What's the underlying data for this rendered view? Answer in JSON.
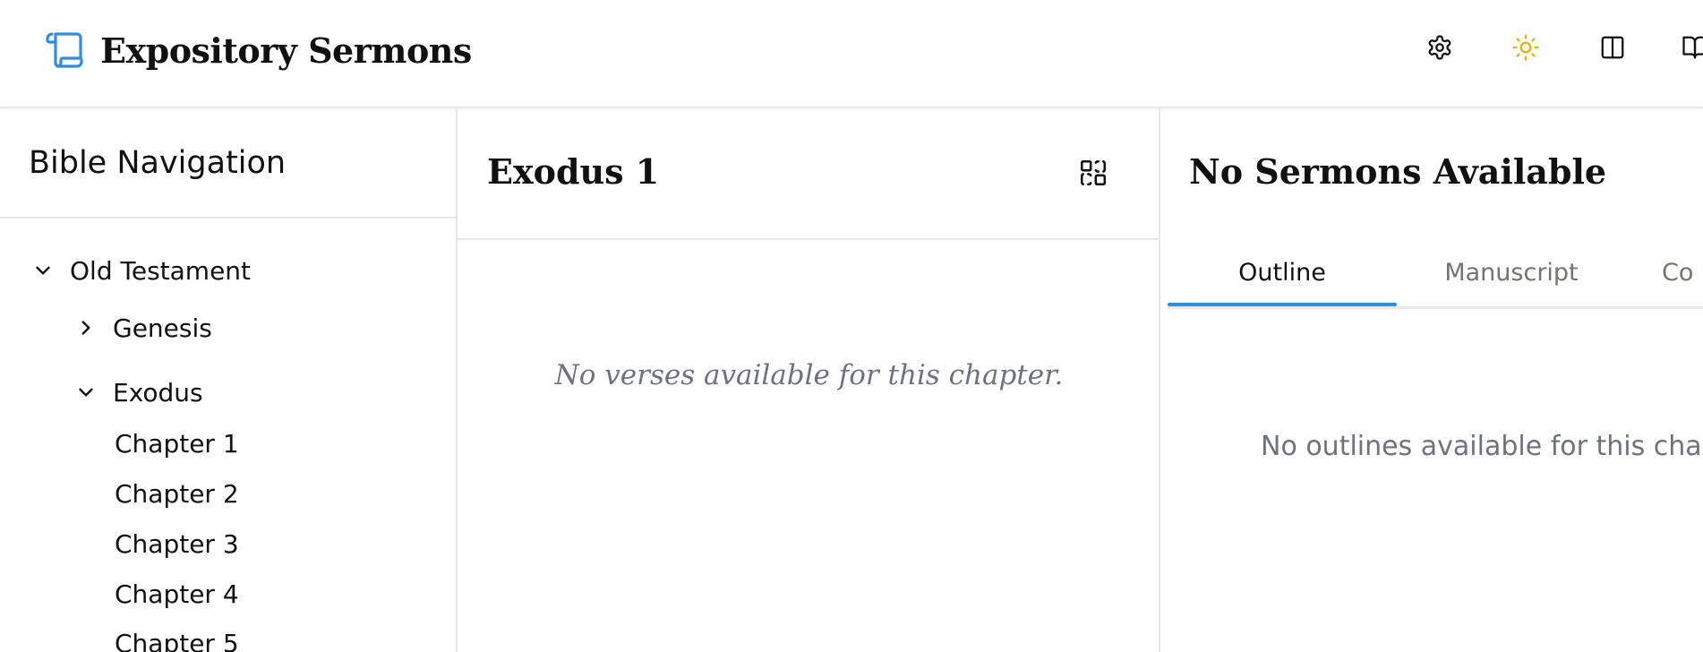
{
  "app": {
    "title": "Expository Sermons",
    "logo_icon": "scroll-icon",
    "accent_color": "#2e8ee0"
  },
  "header_actions": [
    {
      "name": "settings",
      "icon": "gear-icon"
    },
    {
      "name": "theme",
      "icon": "sun-icon",
      "color": "#eab308"
    },
    {
      "name": "layout",
      "icon": "columns-icon"
    },
    {
      "name": "reader",
      "icon": "book-open-icon"
    }
  ],
  "sidebar": {
    "title": "Bible Navigation",
    "tree": {
      "testament": {
        "label": "Old Testament",
        "expanded": true
      },
      "books": [
        {
          "label": "Genesis",
          "expanded": false
        },
        {
          "label": "Exodus",
          "expanded": true
        }
      ],
      "chapters": [
        "Chapter 1",
        "Chapter 2",
        "Chapter 3",
        "Chapter 4",
        "Chapter 5"
      ]
    }
  },
  "passage": {
    "title": "Exodus 1",
    "empty_message": "No verses available for this chapter.",
    "swap_icon": "swap-panels-icon"
  },
  "sermons": {
    "title": "No Sermons Available",
    "tabs": [
      {
        "label": "Outline",
        "active": true
      },
      {
        "label": "Manuscript",
        "active": false
      },
      {
        "label": "Co",
        "active": false
      }
    ],
    "empty_message": "No outlines available for this cha"
  }
}
